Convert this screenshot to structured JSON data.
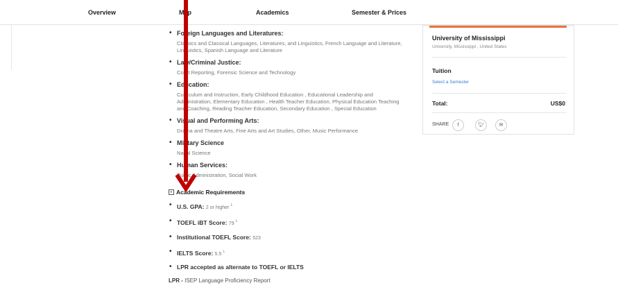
{
  "nav": {
    "tabs": [
      "Overview",
      "Map",
      "Academics",
      "Semester & Prices"
    ]
  },
  "fields": [
    {
      "title": "Foreign Languages and Literatures:",
      "body": "Classics and Classical Languages, Literatures, and Linguistics, French Language and Literature, Linguistics, Spanish Language and Literature"
    },
    {
      "title": "Law/Criminal Justice:",
      "body": "Court Reporting, Forensic Science and Technology"
    },
    {
      "title": "Education:",
      "body": "Curriculum and Instruction, Early Childhood Education , Educational Leadership and Administration, Elementary Education , Health Teacher Education, Physical Education Teaching and Coaching, Reading Teacher Education, Secondary Education , Special Education"
    },
    {
      "title": "Visual and Performing Arts:",
      "body": "Drama and Theatre Arts, Fine Arts and Art Studies, Other, Music Performance"
    },
    {
      "title": "Military Science",
      "body": "Naval Science"
    },
    {
      "title": "Human Services:",
      "body": "Public Administration, Social Work"
    }
  ],
  "requirements": {
    "title": "Academic Requirements",
    "items": [
      {
        "label": "U.S. GPA:",
        "value": "2 or higher",
        "sup": "L"
      },
      {
        "label": "TOEFL iBT Score:",
        "value": "79",
        "sup": "L"
      },
      {
        "label": "Institutional TOEFL Score:",
        "value": "523",
        "sup": ""
      },
      {
        "label": "IELTS Score:",
        "value": "5.5",
        "sup": "L"
      },
      {
        "label": "LPR accepted as alternate to TOEFL or IELTS",
        "value": "",
        "sup": ""
      }
    ],
    "lpr_abbr": "LPR -",
    "lpr_text": " ISEP Language Proficiency Report"
  },
  "card": {
    "university": "University of Mississippi",
    "location": "University, Mississippi , United States",
    "tuition_label": "Tuition",
    "select_semester": "Select a Semester",
    "total_label": "Total:",
    "total_amount": "US$0",
    "share_label": "SHARE",
    "accent_color": "#e8733a"
  },
  "annotation": {
    "color": "#c00000"
  }
}
